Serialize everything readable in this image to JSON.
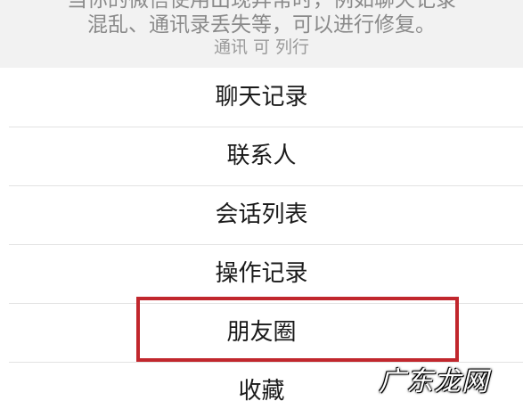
{
  "header": {
    "description_line1": "当你的微信使用出现异常时，例如聊天记录",
    "description_line2": "混乱、通讯录丢失等，可以进行修复。",
    "sub_note": "通讯   可     列行"
  },
  "menu": {
    "items": [
      {
        "label": "聊天记录"
      },
      {
        "label": "联系人"
      },
      {
        "label": "会话列表"
      },
      {
        "label": "操作记录"
      },
      {
        "label": "朋友圈"
      },
      {
        "label": "收藏"
      }
    ]
  },
  "highlight": {
    "color": "#c1272d",
    "target": "朋友圈"
  },
  "watermark": {
    "text": "广东龙网"
  }
}
